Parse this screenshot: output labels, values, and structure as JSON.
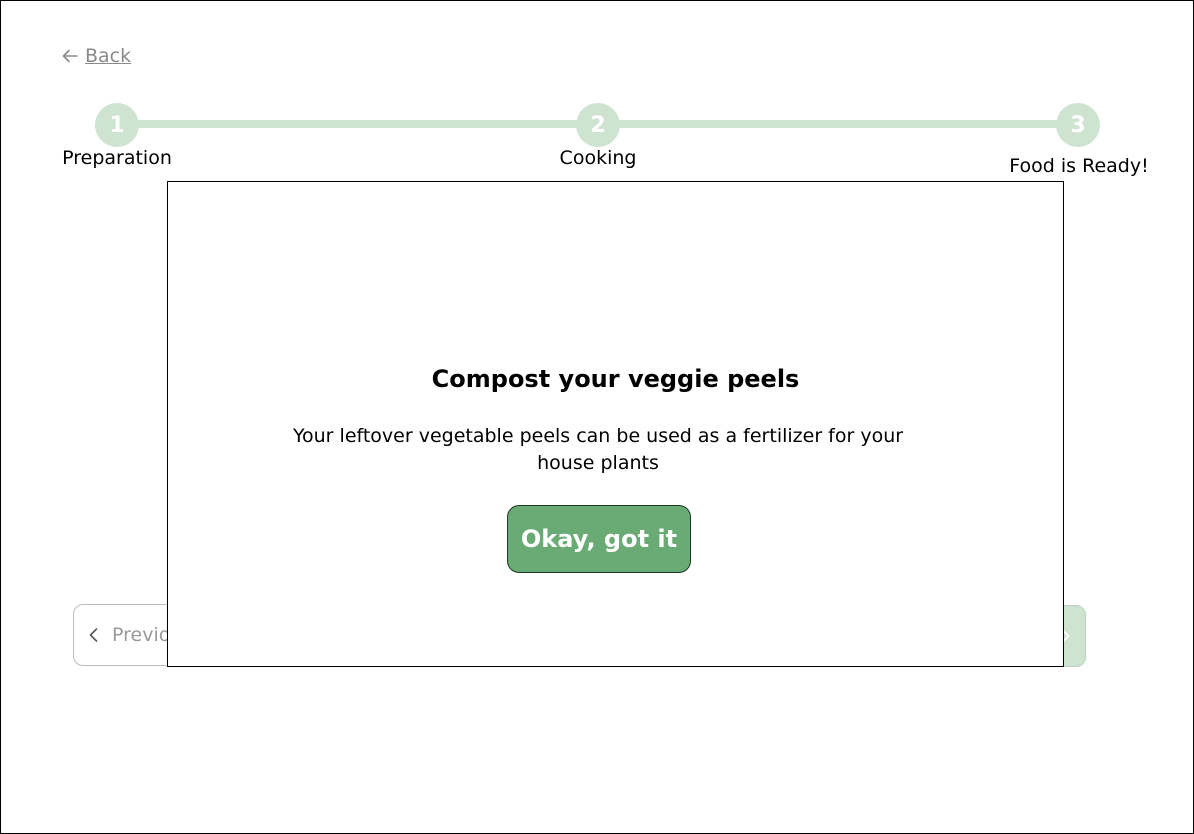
{
  "nav": {
    "back_label": "Back",
    "back_icon": "arrow-left-icon"
  },
  "stepper": {
    "steps": [
      {
        "number": "1",
        "label": "Preparation"
      },
      {
        "number": "2",
        "label": "Cooking"
      },
      {
        "number": "3",
        "label": "Food is Ready!"
      }
    ]
  },
  "footer": {
    "previous_label": "Previo",
    "previous_icon": "chevron-left-icon",
    "next_icon": "chevron-right-icon"
  },
  "modal": {
    "title": "Compost your veggie peels",
    "body": "Your leftover vegetable peels can be used as a fertilizer for your house plants",
    "button_label": "Okay, got it"
  },
  "colors": {
    "accent": "#6aab75",
    "accent_light": "#cfe3d1"
  }
}
